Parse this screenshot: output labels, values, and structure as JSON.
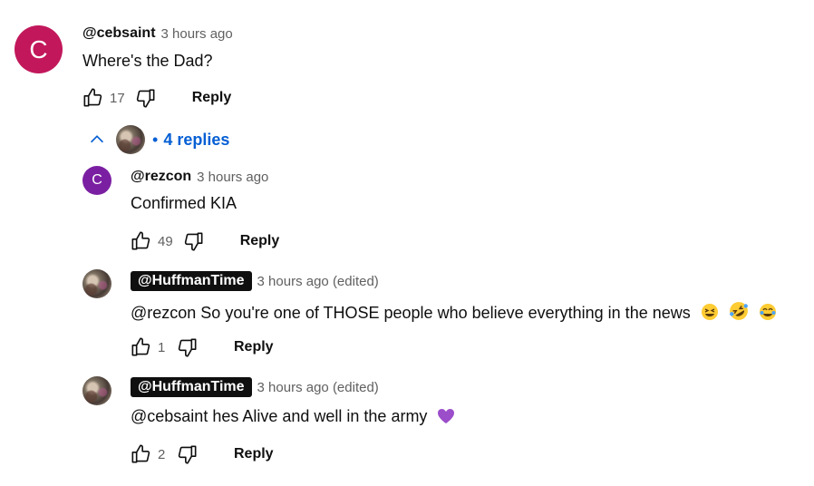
{
  "comments": [
    {
      "author": "@cebsaint",
      "time": "3 hours ago",
      "text": "Where's the Dad?",
      "likes": "17",
      "reply_label": "Reply",
      "avatar_letter": "C",
      "avatar_color": "#c2185b"
    }
  ],
  "replies_toggle": {
    "label": "4 replies",
    "icon": "chevron-up-icon"
  },
  "replies": [
    {
      "author": "@rezcon",
      "time": "3 hours ago",
      "text": "Confirmed KIA",
      "likes": "49",
      "reply_label": "Reply",
      "avatar_letter": "C",
      "avatar_color": "#7b1fa2"
    },
    {
      "author": "@HuffmanTime",
      "time": "3 hours ago (edited)",
      "text": "@rezcon So you're one of THOSE people who believe everything in the news",
      "emojis": [
        "laughing-face",
        "rolling-on-floor-laughing",
        "tears-of-joy"
      ],
      "likes": "1",
      "reply_label": "Reply"
    },
    {
      "author": "@HuffmanTime",
      "time": "3 hours ago (edited)",
      "text": "@cebsaint hes Alive and well in the army",
      "emojis": [
        "purple-heart"
      ],
      "likes": "2",
      "reply_label": "Reply"
    }
  ]
}
